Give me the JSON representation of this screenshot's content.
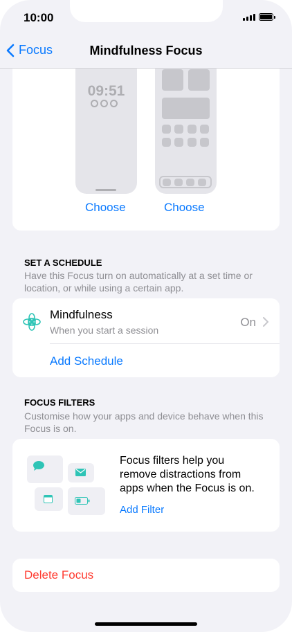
{
  "status_bar": {
    "time": "10:00"
  },
  "nav": {
    "back_label": "Focus",
    "title": "Mindfulness Focus"
  },
  "customize": {
    "lock_screen_time": "09:51",
    "lock_choose_label": "Choose",
    "home_choose_label": "Choose"
  },
  "schedule": {
    "header": "SET A SCHEDULE",
    "description": "Have this Focus turn on automatically at a set time or location, or while using a certain app.",
    "item_title": "Mindfulness",
    "item_subtitle": "When you start a session",
    "item_value": "On",
    "add_label": "Add Schedule",
    "icon": "mindfulness-flower-icon",
    "accent": "#2ec4b6"
  },
  "filters": {
    "header": "FOCUS FILTERS",
    "description": "Customise how your apps and device behave when this Focus is on.",
    "body": "Focus filters help you remove distractions from apps when the Focus is on.",
    "add_label": "Add Filter",
    "icons": [
      "message-icon",
      "mail-icon",
      "calendar-icon",
      "battery-icon"
    ]
  },
  "delete": {
    "label": "Delete Focus",
    "color": "#ff3b30"
  },
  "colors": {
    "accent": "#0a7aff",
    "background": "#f2f2f7"
  }
}
